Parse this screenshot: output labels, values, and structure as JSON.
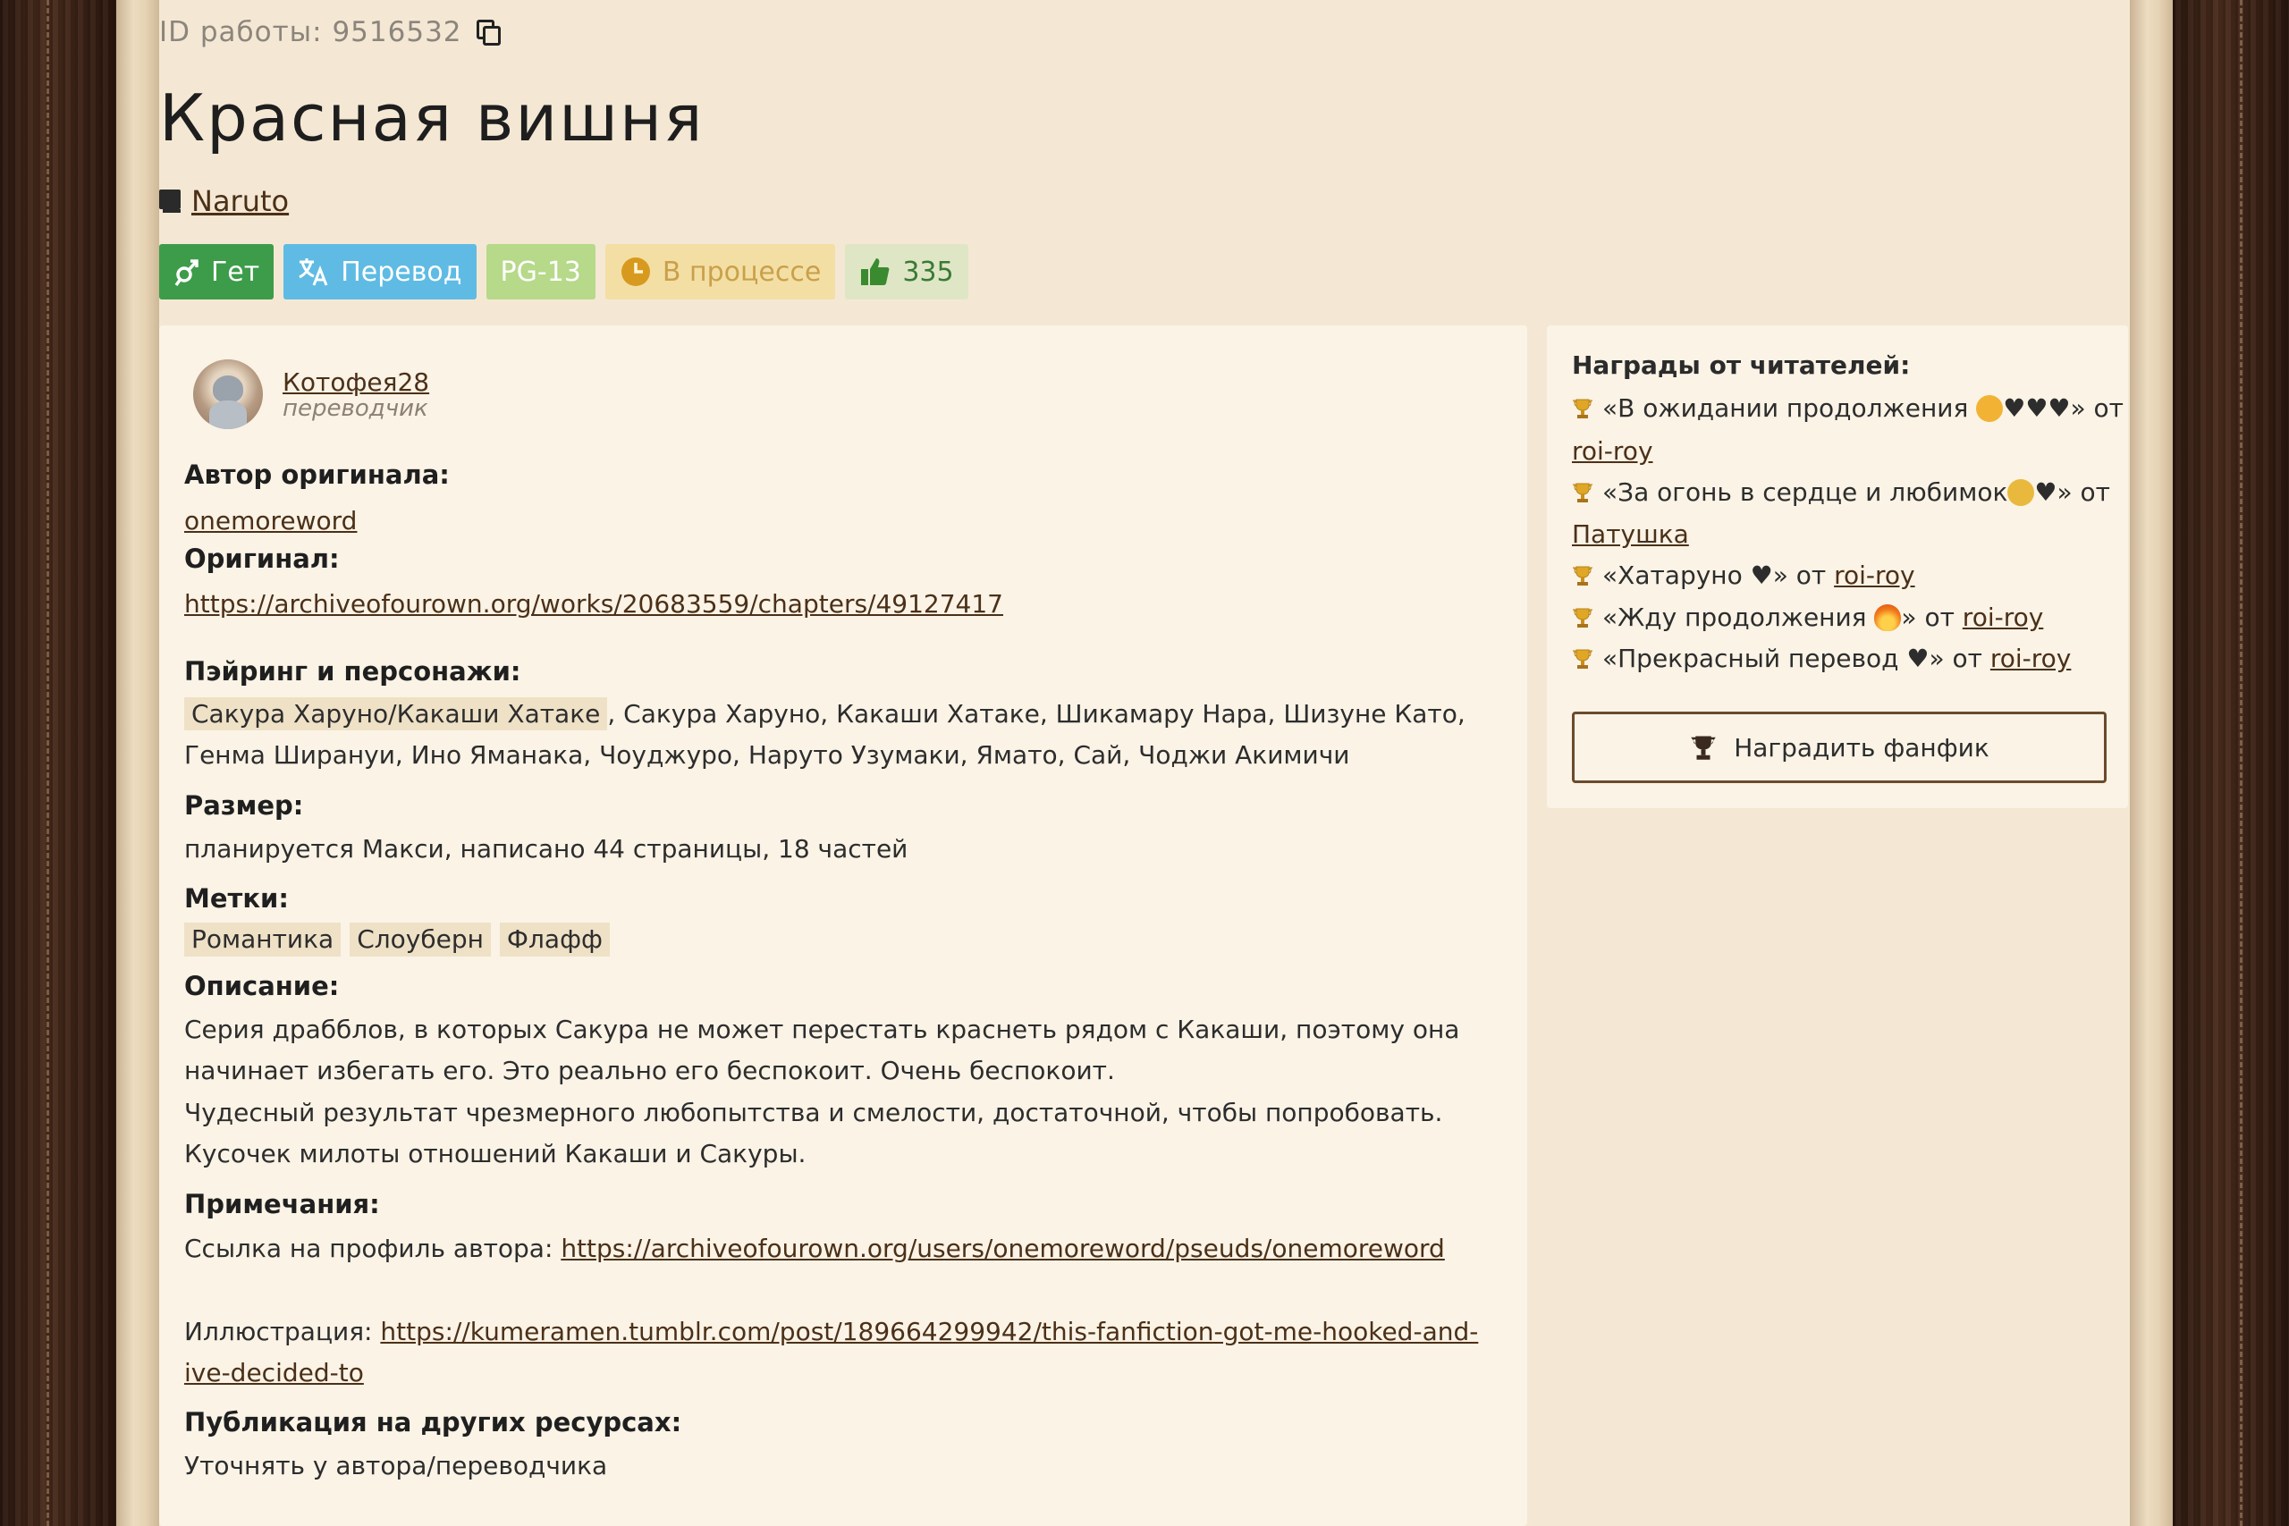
{
  "work": {
    "id_label": "ID работы: 9516532",
    "title": "Красная вишня",
    "fandom": "Naruto"
  },
  "badges": {
    "direction": "Гет",
    "type": "Перевод",
    "rating": "PG-13",
    "status": "В процессе",
    "likes": "335"
  },
  "colors": {
    "direction_badge": "#3d9c4a",
    "translate_badge": "#5fbbe3",
    "rating_badge": "#b6d98a",
    "status_badge": "#f3dfa4",
    "likes_badge": "#dfe6c6",
    "link": "#4b3018"
  },
  "author": {
    "name": "Котофея28",
    "role": "переводчик"
  },
  "details": {
    "original_author_label": "Автор оригинала:",
    "original_author": "onemoreword",
    "original_label": "Оригинал:",
    "original_url": "https://archiveofourown.org/works/20683559/chapters/49127417",
    "pairing_label": "Пэйринг и персонажи:",
    "pairing_main": "Сакура Харуно/Какаши Хатаке",
    "characters_line1": ", Сакура Харуно, Какаши Хатаке, Шикамару Нара, Шизуне Като,",
    "characters_line2": "Генма Ширануи, Ино Яманака, Чоуджуро, Наруто Узумаки, Ямато, Сай, Чоджи Акимичи",
    "size_label": "Размер:",
    "size_value": "планируется Макси, написано 44 страницы, 18 частей",
    "tags_label": "Метки:",
    "tags": [
      "Романтика",
      "Слоуберн",
      "Флафф"
    ],
    "description_label": "Описание:",
    "description_lines": [
      "Серия драбблов, в которых Сакура не может перестать краснеть рядом с Какаши, поэтому она",
      "начинает избегать его. Это реально его беспокоит. Очень беспокоит.",
      "Чудесный результат чрезмерного любопытства и смелости, достаточной, чтобы попробовать.",
      "Кусочек милоты отношений Какаши и Сакуры."
    ],
    "notes_label": "Примечания:",
    "notes_profile_prefix": "Ссылка на профиль автора: ",
    "notes_profile_url": "https://archiveofourown.org/users/onemoreword/pseuds/onemoreword",
    "notes_illustration_prefix": "Иллюстрация: ",
    "notes_illustration_url_1": "https://kumeramen.tumblr.com/post/189664299942/this-fanfiction-got-me-hooked-and-",
    "notes_illustration_url_2": "ive-decided-to",
    "publication_label": "Публикация на других ресурсах:",
    "publication_value": "Уточнять у автора/переводчика"
  },
  "awards": {
    "title": "Награды от читателей:",
    "items": [
      {
        "text": "«В ожидании продолжения ",
        "emoji": "smiling-face",
        "suffix": "♥♥♥» от",
        "from": "roi-roy"
      },
      {
        "text": "«За огонь в сердце и любимок",
        "emoji": "worried-face",
        "suffix": "♥» от",
        "from": "Патушка"
      },
      {
        "text": "«Хатаруно ♥» от ",
        "from": "roi-roy"
      },
      {
        "text": "«Жду продолжения ",
        "emoji": "fire",
        "suffix": "» от ",
        "from": "roi-roy"
      },
      {
        "text": "«Прекрасный перевод ♥» от ",
        "from": "roi-roy"
      }
    ],
    "button_label": "Наградить фанфик"
  }
}
